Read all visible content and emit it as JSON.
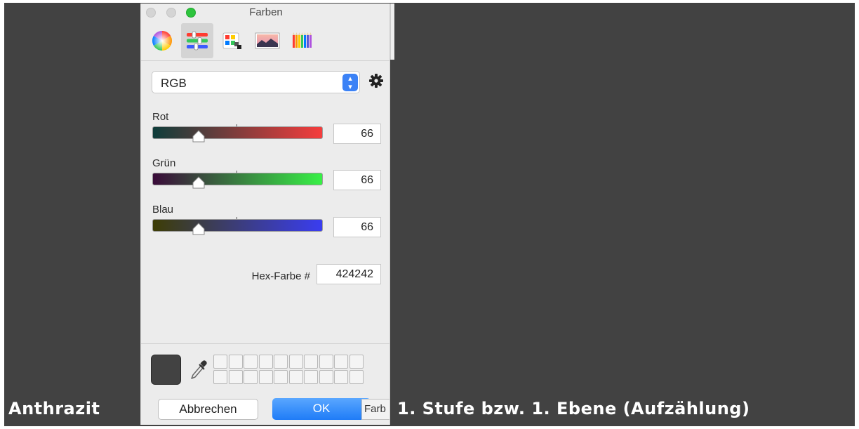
{
  "window": {
    "title": "Farben"
  },
  "toolbar": {
    "tools": [
      {
        "icon": "color-wheel-icon"
      },
      {
        "icon": "color-sliders-icon",
        "active": true
      },
      {
        "icon": "color-palettes-icon"
      },
      {
        "icon": "image-palettes-icon"
      },
      {
        "icon": "pencils-icon"
      }
    ]
  },
  "mode": {
    "selected": "RGB",
    "gear_icon": "gear-icon"
  },
  "sliders": [
    {
      "label": "Rot",
      "value": "66",
      "gradient": [
        "#0e3d3b",
        "#f53d3d"
      ]
    },
    {
      "label": "Grün",
      "value": "66",
      "gradient": [
        "#3a0b3a",
        "#38f046"
      ]
    },
    {
      "label": "Blau",
      "value": "66",
      "gradient": [
        "#3d3d05",
        "#3a3df0"
      ]
    }
  ],
  "hex": {
    "label": "Hex-Farbe #",
    "value": "424242"
  },
  "current_color": "#424242",
  "buttons": {
    "cancel": "Abbrechen",
    "ok": "OK"
  },
  "tooltip_fragment": "Farb",
  "captions": {
    "left": "Anthrazit",
    "right": "1. Stufe bzw. 1. Ebene (Aufzählung)"
  },
  "colors": {
    "canvas": "#424242",
    "accent": "#1f7cf7",
    "panel": "#ececec"
  }
}
